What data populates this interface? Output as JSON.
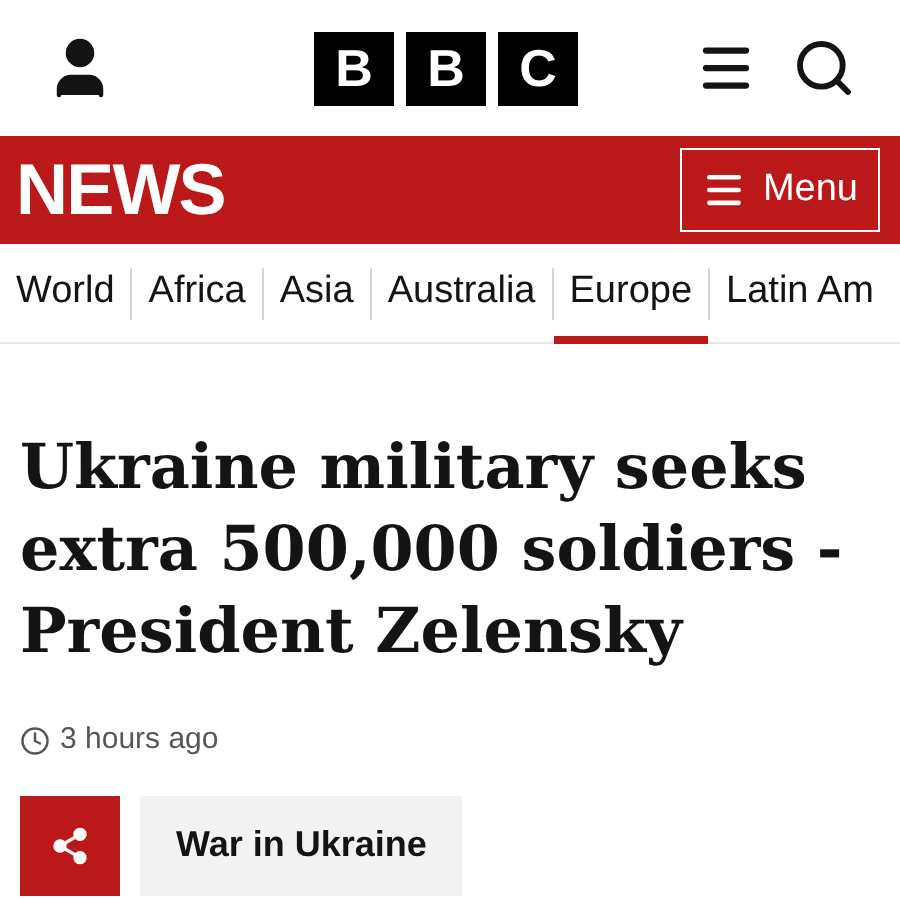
{
  "header": {
    "logo_letters": [
      "B",
      "B",
      "C"
    ]
  },
  "section_bar": {
    "title": "NEWS",
    "menu_button": "Menu"
  },
  "nav": [
    {
      "label": "World",
      "selected": false
    },
    {
      "label": "Africa",
      "selected": false
    },
    {
      "label": "Asia",
      "selected": false
    },
    {
      "label": "Australia",
      "selected": false
    },
    {
      "label": "Europe",
      "selected": true
    },
    {
      "label": "Latin Am",
      "selected": false
    }
  ],
  "article": {
    "headline": "Ukraine military seeks extra 500,000 soldiers - President Zelensky",
    "timestamp": "3 hours ago",
    "topic_tag": "War in Ukraine"
  }
}
